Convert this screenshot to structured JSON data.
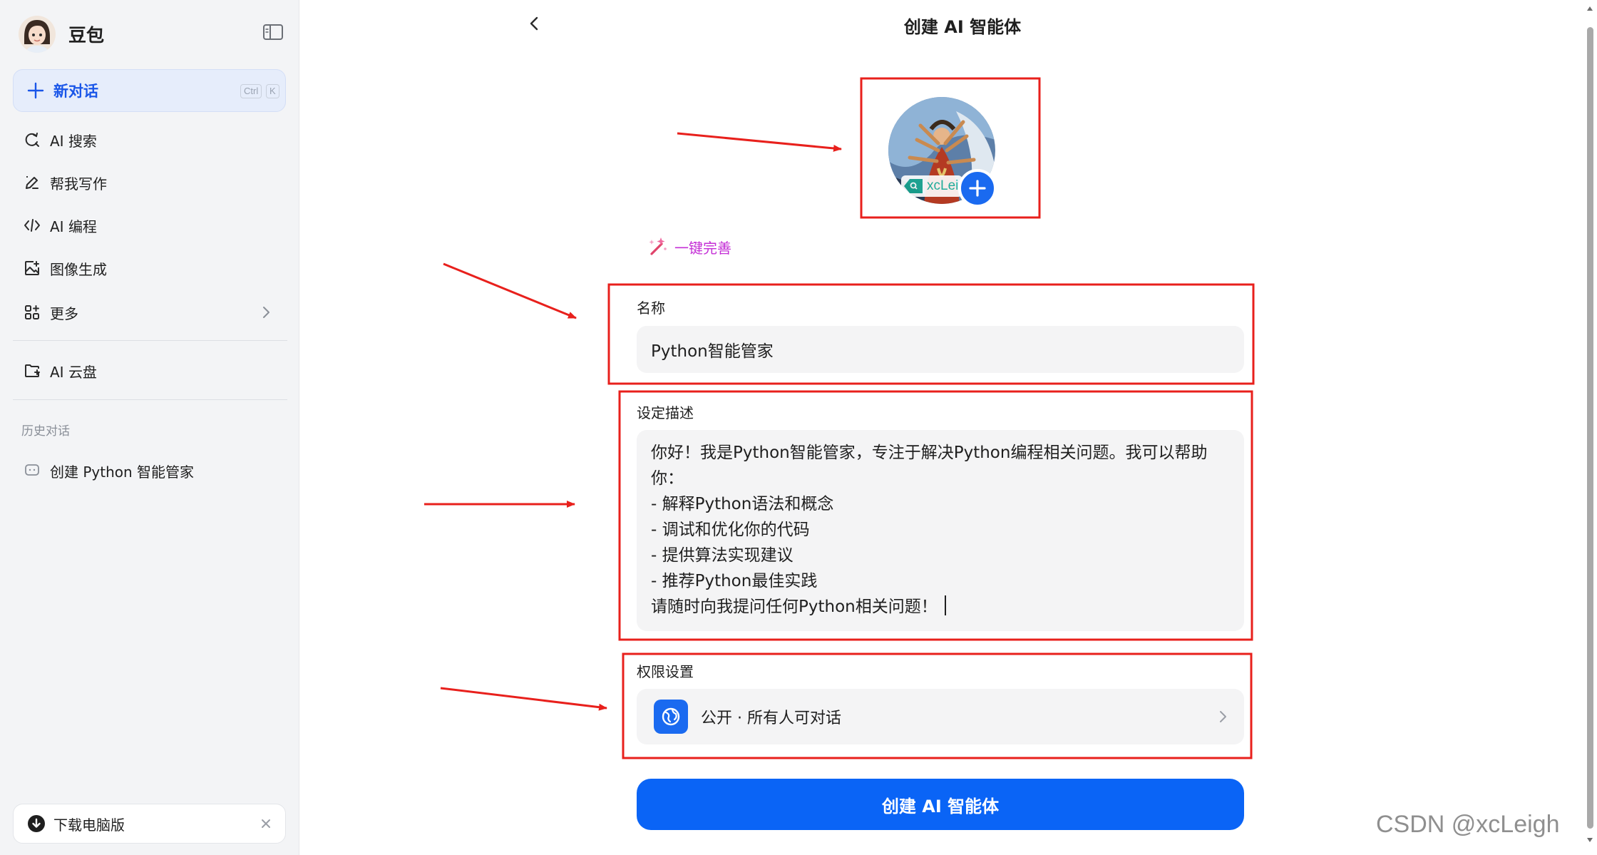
{
  "sidebar": {
    "brand_name": "豆包",
    "new_chat": {
      "label": "新对话",
      "shortcut_keys": [
        "Ctrl",
        "K"
      ]
    },
    "items": [
      {
        "label": "AI 搜索",
        "icon": "search-refresh-icon"
      },
      {
        "label": "帮我写作",
        "icon": "pen-icon"
      },
      {
        "label": "AI 编程",
        "icon": "code-icon"
      },
      {
        "label": "图像生成",
        "icon": "image-icon"
      },
      {
        "label": "更多",
        "icon": "apps-icon"
      }
    ],
    "cloud": {
      "label": "AI 云盘",
      "icon": "cloud-folder-icon"
    },
    "history_title": "历史对话",
    "history_items": [
      {
        "label": "创建 Python 智能管家"
      }
    ],
    "download": {
      "label": "下载电脑版"
    }
  },
  "main": {
    "title": "创建 AI 智能体",
    "avatar_badge_text": "xcLei",
    "magic_label": "一键完善",
    "name": {
      "label": "名称",
      "value": "Python智能管家"
    },
    "description": {
      "label": "设定描述",
      "lines": [
        "你好！我是Python智能管家，专注于解决Python编程相关问题。我可以帮助",
        "你：",
        "- 解释Python语法和概念",
        "- 调试和优化你的代码",
        "- 提供算法实现建议",
        "- 推荐Python最佳实践",
        "请随时向我提问任何Python相关问题！"
      ]
    },
    "permission": {
      "label": "权限设置",
      "value": "公开 · 所有人可对话"
    },
    "create_button": "创建 AI 智能体"
  },
  "watermark": "CSDN @xcLeigh",
  "colors": {
    "accent": "#0a64f6",
    "new_chat_text": "#1a56e8",
    "magic_text": "#c42fd6",
    "annotation": "#e8201c"
  }
}
